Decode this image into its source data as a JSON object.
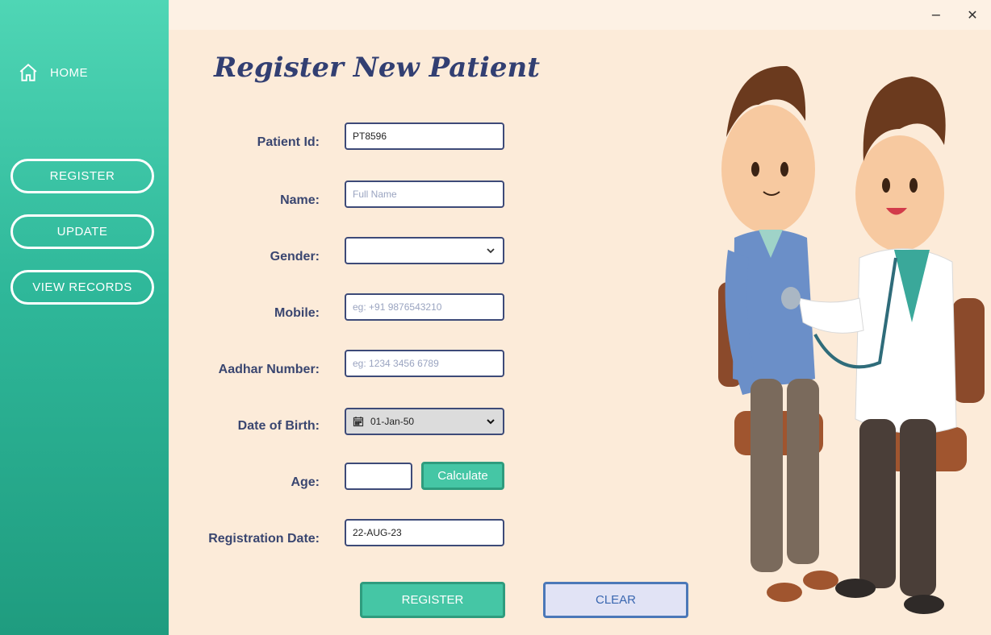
{
  "window": {
    "minimize_glyph": "−",
    "close_glyph": "✕"
  },
  "sidebar": {
    "home_label": "HOME",
    "buttons": [
      {
        "label": "REGISTER"
      },
      {
        "label": "UPDATE"
      },
      {
        "label": "VIEW  RECORDS"
      }
    ]
  },
  "form": {
    "title": "Register New Patient",
    "patient_id": {
      "label": "Patient Id:",
      "value": "PT8596"
    },
    "name": {
      "label": "Name:",
      "placeholder": "Full Name"
    },
    "gender": {
      "label": "Gender:",
      "value": ""
    },
    "mobile": {
      "label": "Mobile:",
      "placeholder": "eg: +91 9876543210"
    },
    "aadhar": {
      "label": "Aadhar Number:",
      "placeholder": "eg: 1234 3456 6789"
    },
    "dob": {
      "label": "Date of Birth:",
      "value": "01-Jan-50"
    },
    "age": {
      "label": "Age:",
      "value": "",
      "calculate_label": "Calculate"
    },
    "reg_date": {
      "label": "Registration Date:",
      "value": "22-AUG-23"
    },
    "register_label": "REGISTER",
    "clear_label": "CLEAR"
  },
  "colors": {
    "accent": "#45c6a5",
    "title": "#323f72",
    "background": "#fcebd9"
  },
  "icons": [
    "home-icon",
    "chevron-down-icon",
    "calendar-icon",
    "minimize-icon",
    "close-icon"
  ]
}
